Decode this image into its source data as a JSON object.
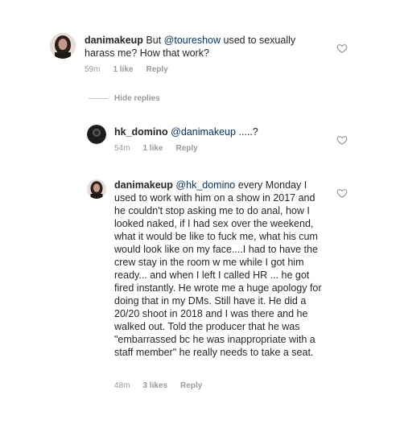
{
  "comments": [
    {
      "username": "danimakeup",
      "pre": " But ",
      "mention": "@toureshow",
      "post": " used to sexually harass me? How that work?",
      "time": "59m",
      "likes": "1 like",
      "reply": "Reply"
    },
    {
      "username": "hk_domino",
      "pre": " ",
      "mention": "@danimakeup",
      "post": " .....?",
      "time": "54m",
      "likes": "1 like",
      "reply": "Reply"
    },
    {
      "username": "danimakeup",
      "pre": " ",
      "mention": "@hk_domino",
      "post": " every Monday I used to work with him on a show in 2017 and he couldn't stop asking me to do anal, how I looked naked, if I had sex over the weekend, what it would be like to fuck me, what his cum would look like on my face....I had to have the crew stay in the room w me while I got him ready... and when I left I called HR ... he got fired instantly. He wrote me a huge apology for doing that in my DMs. Still have it. He did a 20/20 shoot in 2018 and I was there and he walked out. Told the producer that he was \"embarrassed bc he was inappropriate with a staff member\" he really needs to take a seat.",
      "time": "48m",
      "likes": "3 likes",
      "reply": "Reply"
    }
  ],
  "hide_replies": "Hide replies",
  "icons": {
    "like": "heart-outline-icon"
  },
  "colors": {
    "mention": "#003569",
    "meta": "#999999",
    "text": "#262626"
  }
}
